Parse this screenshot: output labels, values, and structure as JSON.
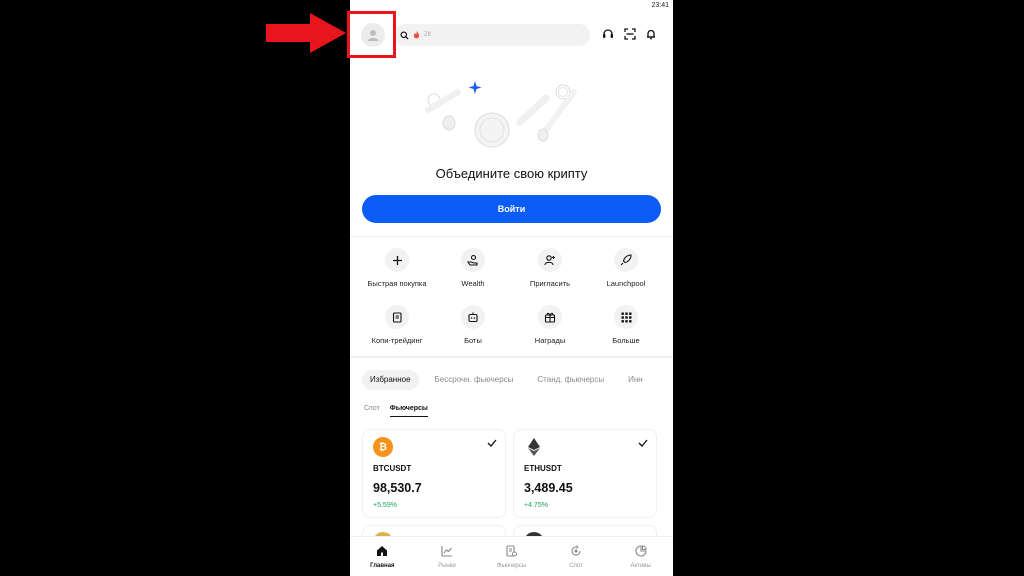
{
  "status_bar": {
    "time": "23:41"
  },
  "header": {
    "search_placeholder": "ZK"
  },
  "hero": {
    "title": "Объедините свою крипту",
    "login_label": "Войти"
  },
  "quick_actions": [
    {
      "label": "Быстрая покупка",
      "icon": "plus-icon"
    },
    {
      "label": "Wealth",
      "icon": "wealth-icon"
    },
    {
      "label": "Пригласить",
      "icon": "invite-icon"
    },
    {
      "label": "Launchpool",
      "icon": "rocket-icon"
    },
    {
      "label": "Копи-трейдинг",
      "icon": "copy-trading-icon"
    },
    {
      "label": "Боты",
      "icon": "bot-icon"
    },
    {
      "label": "Награды",
      "icon": "gift-icon"
    },
    {
      "label": "Больше",
      "icon": "grid-icon"
    }
  ],
  "market_tabs": [
    "Избранное",
    "Бессрочн. фьючерсы",
    "Станд. фьючерсы",
    "Инн"
  ],
  "sub_tabs": [
    "Спот",
    "Фьючерсы"
  ],
  "favorites": [
    {
      "pair": "BTCUSDT",
      "price": "98,530.7",
      "change": "+5.59%",
      "coin_color": "#f7931a"
    },
    {
      "pair": "ETHUSDT",
      "price": "3,489.45",
      "change": "+4.75%",
      "coin_color": "#ffffff"
    }
  ],
  "bottom_nav": [
    {
      "label": "Главная",
      "icon": "home-icon",
      "active": true
    },
    {
      "label": "Рынки",
      "icon": "markets-icon"
    },
    {
      "label": "Фьючерсы",
      "icon": "futures-icon"
    },
    {
      "label": "Спот",
      "icon": "spot-icon"
    },
    {
      "label": "Активы",
      "icon": "assets-icon"
    }
  ],
  "colors": {
    "accent": "#0a5cf5",
    "positive": "#19a45d",
    "annotation": "#e8151c"
  }
}
